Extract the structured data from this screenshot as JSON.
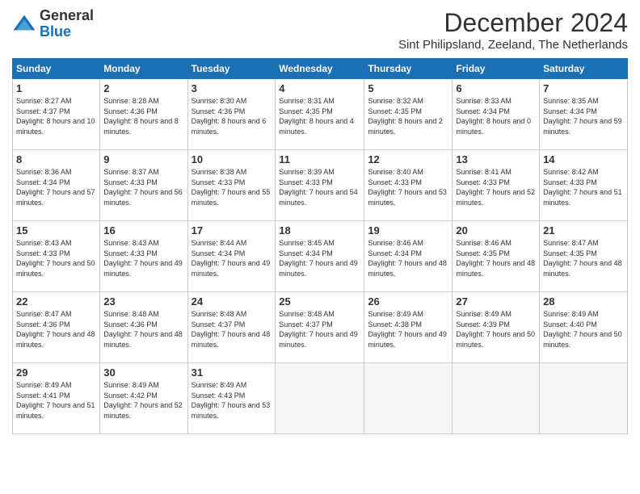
{
  "logo": {
    "general": "General",
    "blue": "Blue"
  },
  "header": {
    "month_year": "December 2024",
    "location": "Sint Philipsland, Zeeland, The Netherlands"
  },
  "days_of_week": [
    "Sunday",
    "Monday",
    "Tuesday",
    "Wednesday",
    "Thursday",
    "Friday",
    "Saturday"
  ],
  "weeks": [
    [
      {
        "day": 1,
        "sunrise": "8:27 AM",
        "sunset": "4:37 PM",
        "daylight": "8 hours and 10 minutes"
      },
      {
        "day": 2,
        "sunrise": "8:28 AM",
        "sunset": "4:36 PM",
        "daylight": "8 hours and 8 minutes"
      },
      {
        "day": 3,
        "sunrise": "8:30 AM",
        "sunset": "4:36 PM",
        "daylight": "8 hours and 6 minutes"
      },
      {
        "day": 4,
        "sunrise": "8:31 AM",
        "sunset": "4:35 PM",
        "daylight": "8 hours and 4 minutes"
      },
      {
        "day": 5,
        "sunrise": "8:32 AM",
        "sunset": "4:35 PM",
        "daylight": "8 hours and 2 minutes"
      },
      {
        "day": 6,
        "sunrise": "8:33 AM",
        "sunset": "4:34 PM",
        "daylight": "8 hours and 0 minutes"
      },
      {
        "day": 7,
        "sunrise": "8:35 AM",
        "sunset": "4:34 PM",
        "daylight": "7 hours and 59 minutes"
      }
    ],
    [
      {
        "day": 8,
        "sunrise": "8:36 AM",
        "sunset": "4:34 PM",
        "daylight": "7 hours and 57 minutes"
      },
      {
        "day": 9,
        "sunrise": "8:37 AM",
        "sunset": "4:33 PM",
        "daylight": "7 hours and 56 minutes"
      },
      {
        "day": 10,
        "sunrise": "8:38 AM",
        "sunset": "4:33 PM",
        "daylight": "7 hours and 55 minutes"
      },
      {
        "day": 11,
        "sunrise": "8:39 AM",
        "sunset": "4:33 PM",
        "daylight": "7 hours and 54 minutes"
      },
      {
        "day": 12,
        "sunrise": "8:40 AM",
        "sunset": "4:33 PM",
        "daylight": "7 hours and 53 minutes"
      },
      {
        "day": 13,
        "sunrise": "8:41 AM",
        "sunset": "4:33 PM",
        "daylight": "7 hours and 52 minutes"
      },
      {
        "day": 14,
        "sunrise": "8:42 AM",
        "sunset": "4:33 PM",
        "daylight": "7 hours and 51 minutes"
      }
    ],
    [
      {
        "day": 15,
        "sunrise": "8:43 AM",
        "sunset": "4:33 PM",
        "daylight": "7 hours and 50 minutes"
      },
      {
        "day": 16,
        "sunrise": "8:43 AM",
        "sunset": "4:33 PM",
        "daylight": "7 hours and 49 minutes"
      },
      {
        "day": 17,
        "sunrise": "8:44 AM",
        "sunset": "4:34 PM",
        "daylight": "7 hours and 49 minutes"
      },
      {
        "day": 18,
        "sunrise": "8:45 AM",
        "sunset": "4:34 PM",
        "daylight": "7 hours and 49 minutes"
      },
      {
        "day": 19,
        "sunrise": "8:46 AM",
        "sunset": "4:34 PM",
        "daylight": "7 hours and 48 minutes"
      },
      {
        "day": 20,
        "sunrise": "8:46 AM",
        "sunset": "4:35 PM",
        "daylight": "7 hours and 48 minutes"
      },
      {
        "day": 21,
        "sunrise": "8:47 AM",
        "sunset": "4:35 PM",
        "daylight": "7 hours and 48 minutes"
      }
    ],
    [
      {
        "day": 22,
        "sunrise": "8:47 AM",
        "sunset": "4:36 PM",
        "daylight": "7 hours and 48 minutes"
      },
      {
        "day": 23,
        "sunrise": "8:48 AM",
        "sunset": "4:36 PM",
        "daylight": "7 hours and 48 minutes"
      },
      {
        "day": 24,
        "sunrise": "8:48 AM",
        "sunset": "4:37 PM",
        "daylight": "7 hours and 48 minutes"
      },
      {
        "day": 25,
        "sunrise": "8:48 AM",
        "sunset": "4:37 PM",
        "daylight": "7 hours and 49 minutes"
      },
      {
        "day": 26,
        "sunrise": "8:49 AM",
        "sunset": "4:38 PM",
        "daylight": "7 hours and 49 minutes"
      },
      {
        "day": 27,
        "sunrise": "8:49 AM",
        "sunset": "4:39 PM",
        "daylight": "7 hours and 50 minutes"
      },
      {
        "day": 28,
        "sunrise": "8:49 AM",
        "sunset": "4:40 PM",
        "daylight": "7 hours and 50 minutes"
      }
    ],
    [
      {
        "day": 29,
        "sunrise": "8:49 AM",
        "sunset": "4:41 PM",
        "daylight": "7 hours and 51 minutes"
      },
      {
        "day": 30,
        "sunrise": "8:49 AM",
        "sunset": "4:42 PM",
        "daylight": "7 hours and 52 minutes"
      },
      {
        "day": 31,
        "sunrise": "8:49 AM",
        "sunset": "4:43 PM",
        "daylight": "7 hours and 53 minutes"
      },
      null,
      null,
      null,
      null
    ]
  ]
}
